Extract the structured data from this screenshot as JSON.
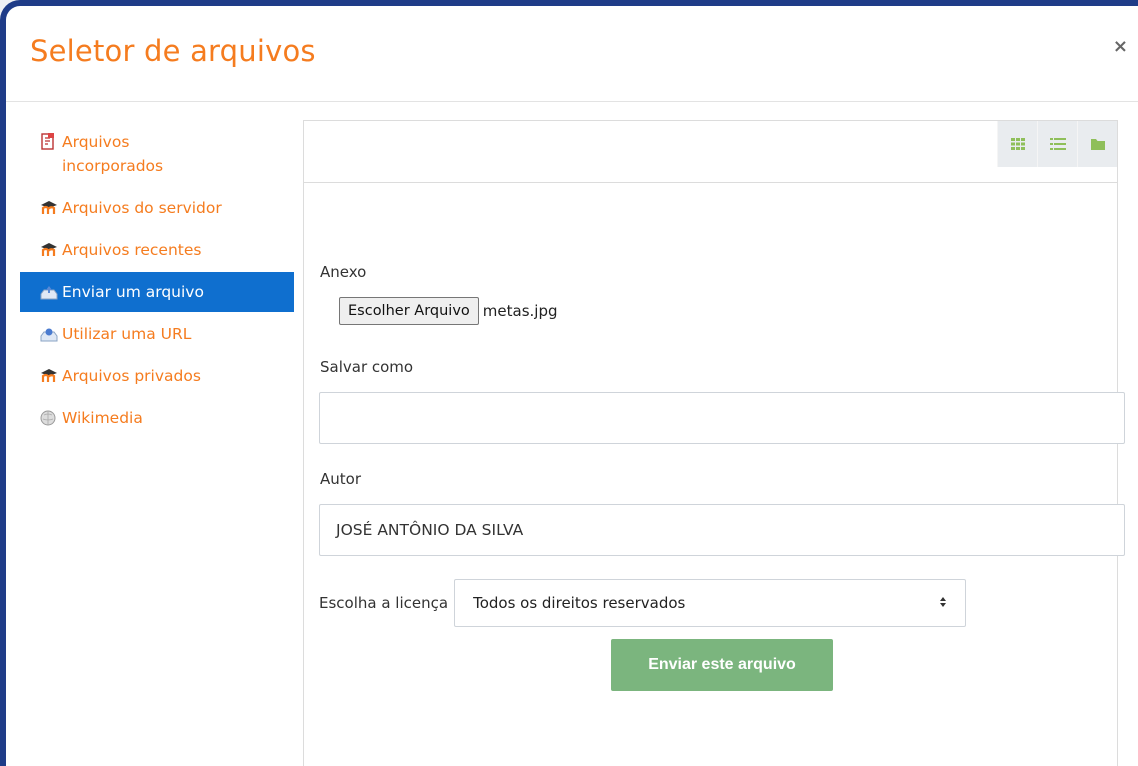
{
  "dialog": {
    "title": "Seletor de arquivos",
    "close_symbol": "×"
  },
  "sidebar": {
    "items": [
      {
        "label": "Arquivos incorporados",
        "icon": "embedded-files-icon",
        "active": false
      },
      {
        "label": "Arquivos do servidor",
        "icon": "moodle-icon",
        "active": false
      },
      {
        "label": "Arquivos recentes",
        "icon": "moodle-icon",
        "active": false
      },
      {
        "label": "Enviar um arquivo",
        "icon": "upload-icon",
        "active": true
      },
      {
        "label": "Utilizar uma URL",
        "icon": "url-icon",
        "active": false
      },
      {
        "label": "Arquivos privados",
        "icon": "moodle-icon",
        "active": false
      },
      {
        "label": "Wikimedia",
        "icon": "wikimedia-icon",
        "active": false
      }
    ]
  },
  "toolbar": {
    "views": [
      "grid-view-icon",
      "list-view-icon",
      "folder-view-icon"
    ]
  },
  "form": {
    "attachment_label": "Anexo",
    "choose_file_label": "Escolher Arquivo",
    "file_name": "metas.jpg",
    "save_as_label": "Salvar como",
    "save_as_value": "",
    "author_label": "Autor",
    "author_value": "JOSÉ ANTÔNIO DA SILVA",
    "license_label": "Escolha a licença",
    "license_value": "Todos os direitos reservados",
    "submit_label": "Enviar este arquivo"
  },
  "colors": {
    "accent": "#f57c1f",
    "active_bg": "#0f6fcf",
    "submit_bg": "#7bb57e",
    "frame": "#1f3c88"
  }
}
